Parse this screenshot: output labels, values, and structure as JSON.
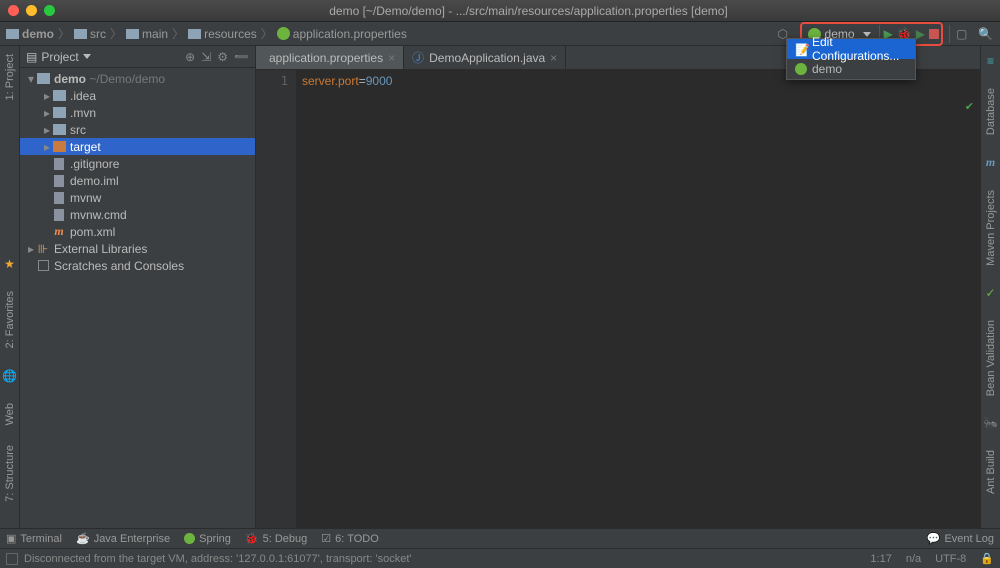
{
  "title": "demo [~/Demo/demo] - .../src/main/resources/application.properties [demo]",
  "breadcrumb": [
    {
      "icon": "folder",
      "label": "demo"
    },
    {
      "icon": "folder",
      "label": "src"
    },
    {
      "icon": "folder",
      "label": "main"
    },
    {
      "icon": "folder",
      "label": "resources"
    },
    {
      "icon": "spring",
      "label": "application.properties"
    }
  ],
  "run_config_selected": "demo",
  "dropdown": {
    "edit_config": "Edit Configurations...",
    "items": [
      {
        "icon": "spring",
        "label": "demo"
      }
    ]
  },
  "project_tool": {
    "title": "Project"
  },
  "left_tools": [
    "1: Project",
    "2: Favorites",
    "Web",
    "7: Structure"
  ],
  "right_tools": [
    "Database",
    "Maven Projects",
    "Bean Validation",
    "Ant Build"
  ],
  "tree": [
    {
      "depth": 0,
      "arrow": "open",
      "icon": "dir",
      "label": "demo",
      "suffix": " ~/Demo/demo",
      "bold": true
    },
    {
      "depth": 1,
      "arrow": "closed",
      "icon": "dir",
      "label": ".idea"
    },
    {
      "depth": 1,
      "arrow": "closed",
      "icon": "dir",
      "label": ".mvn"
    },
    {
      "depth": 1,
      "arrow": "closed",
      "icon": "dir",
      "label": "src"
    },
    {
      "depth": 1,
      "arrow": "closed",
      "icon": "dir-orange",
      "label": "target",
      "selected": true
    },
    {
      "depth": 1,
      "arrow": "none",
      "icon": "file",
      "label": ".gitignore"
    },
    {
      "depth": 1,
      "arrow": "none",
      "icon": "file",
      "label": "demo.iml"
    },
    {
      "depth": 1,
      "arrow": "none",
      "icon": "file",
      "label": "mvnw"
    },
    {
      "depth": 1,
      "arrow": "none",
      "icon": "file",
      "label": "mvnw.cmd"
    },
    {
      "depth": 1,
      "arrow": "none",
      "icon": "m",
      "label": "pom.xml"
    },
    {
      "depth": 0,
      "arrow": "closed",
      "icon": "lib",
      "label": "External Libraries"
    },
    {
      "depth": 0,
      "arrow": "none",
      "icon": "scratch",
      "label": "Scratches and Consoles"
    }
  ],
  "tabs": [
    {
      "icon": "spring",
      "label": "application.properties",
      "active": true
    },
    {
      "icon": "java",
      "label": "DemoApplication.java",
      "active": false
    }
  ],
  "code": {
    "line_num": "1",
    "key": "server.port",
    "eq": "=",
    "val": "9000"
  },
  "bottom_tabs": {
    "terminal": "Terminal",
    "java_ee": "Java Enterprise",
    "spring": "Spring",
    "debug": "5: Debug",
    "todo": "6: TODO",
    "event_log": "Event Log"
  },
  "status": {
    "message": "Disconnected from the target VM, address: '127.0.0.1:61077', transport: 'socket'",
    "pos": "1:17",
    "ro": "n/a",
    "enc": "UTF-8"
  }
}
